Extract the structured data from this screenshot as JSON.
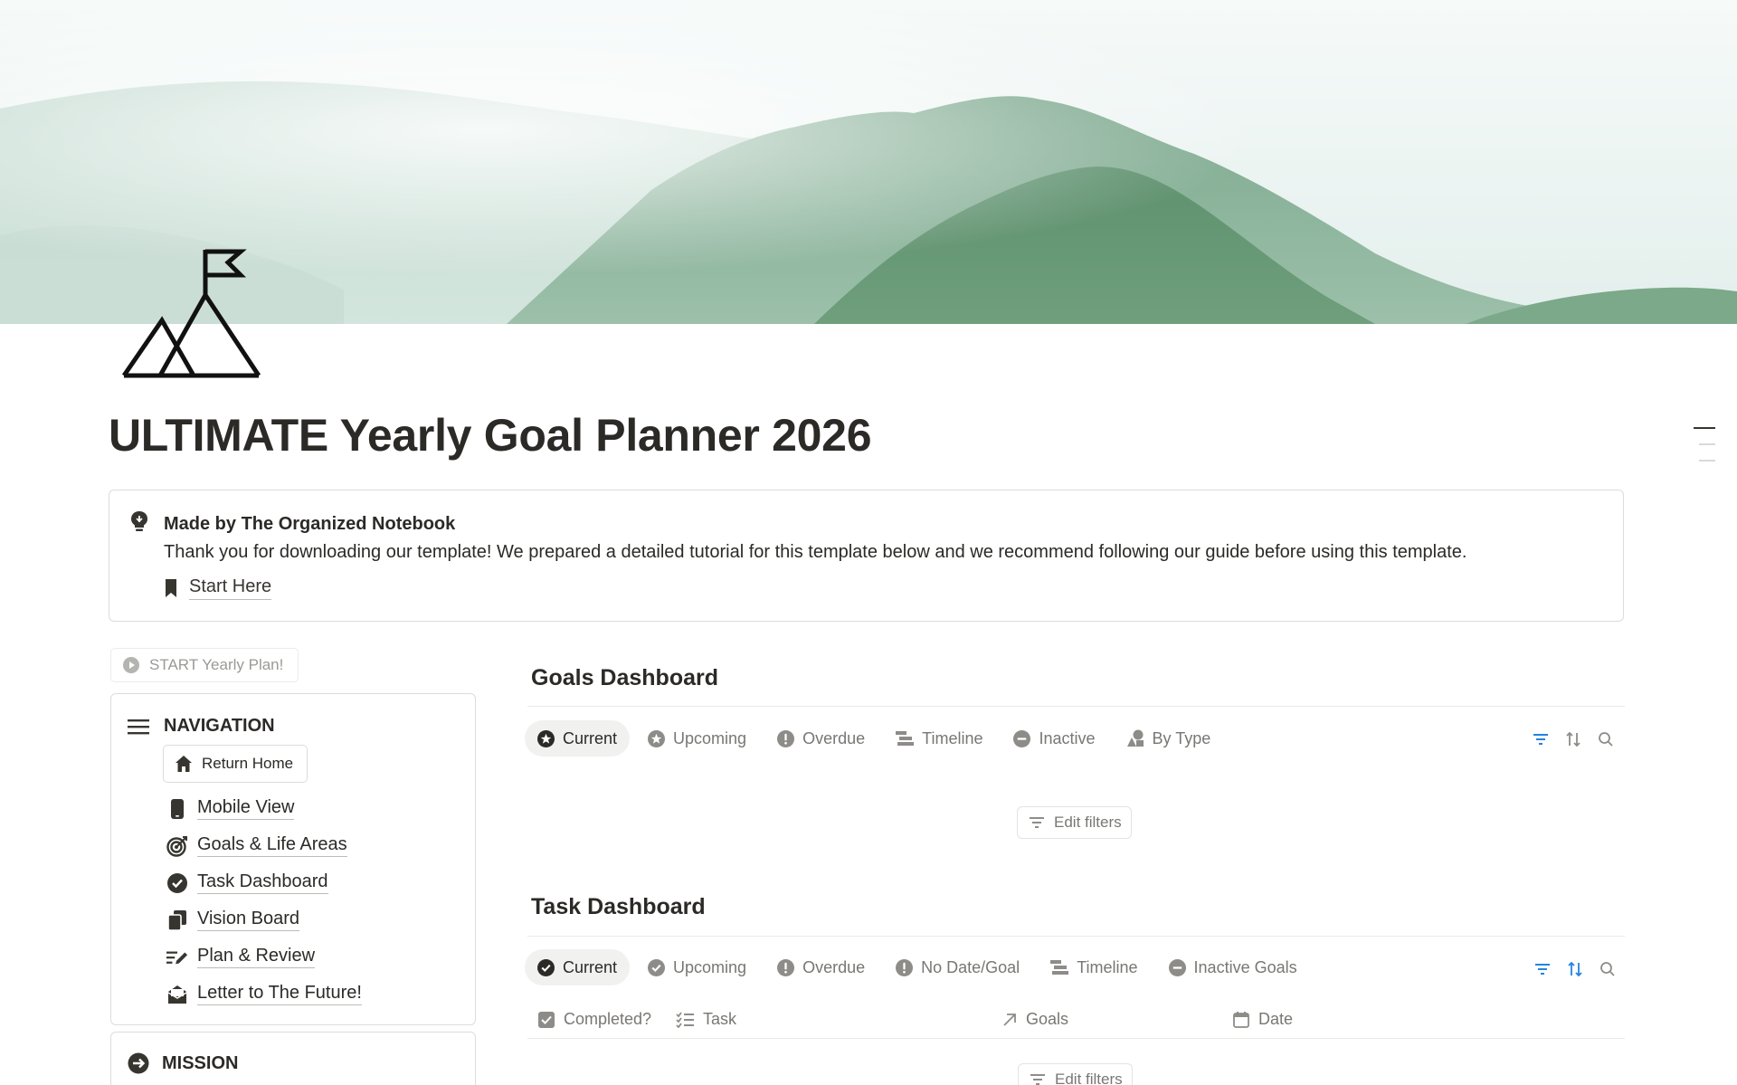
{
  "page": {
    "title": "ULTIMATE Yearly Goal Planner 2026"
  },
  "icons": {
    "page_icon": "mountain-flag-icon",
    "callout_icon": "lightbulb-icon",
    "start_here_icon": "bookmark-icon",
    "start_plan_icon": "play-circle-icon",
    "navigation_icon": "menu-icon",
    "mission_icon": "arrow-circle-right-icon"
  },
  "callout": {
    "title": "Made by The Organized Notebook",
    "body": "Thank you for downloading our template! We prepared a detailed tutorial for this template below and we recommend following our guide before using this template.",
    "link": "Start Here"
  },
  "sidebar": {
    "start_button": "START Yearly Plan!",
    "navigation": {
      "heading": "NAVIGATION",
      "return_home": "Return Home",
      "items": [
        {
          "label": "Mobile View",
          "icon": "phone-icon"
        },
        {
          "label": "Goals & Life Areas",
          "icon": "target-icon"
        },
        {
          "label": "Task Dashboard",
          "icon": "check-circle-icon"
        },
        {
          "label": "Vision Board",
          "icon": "copy-icon"
        },
        {
          "label": "Plan & Review",
          "icon": "edit-list-icon"
        },
        {
          "label": "Letter to The Future!",
          "icon": "letter-icon"
        }
      ]
    },
    "mission": {
      "heading": "MISSION"
    }
  },
  "goals_dashboard": {
    "title": "Goals Dashboard",
    "tabs": [
      {
        "label": "Current",
        "icon": "star-circle-icon",
        "active": true
      },
      {
        "label": "Upcoming",
        "icon": "star-circle-icon",
        "active": false
      },
      {
        "label": "Overdue",
        "icon": "exclamation-circle-icon",
        "active": false
      },
      {
        "label": "Timeline",
        "icon": "timeline-icon",
        "active": false
      },
      {
        "label": "Inactive",
        "icon": "minus-circle-icon",
        "active": false
      },
      {
        "label": "By Type",
        "icon": "shapes-icon",
        "active": false
      }
    ],
    "edit_filters": "Edit filters"
  },
  "task_dashboard": {
    "title": "Task Dashboard",
    "tabs": [
      {
        "label": "Current",
        "icon": "check-circle-icon",
        "active": true
      },
      {
        "label": "Upcoming",
        "icon": "check-circle-icon",
        "active": false
      },
      {
        "label": "Overdue",
        "icon": "exclamation-circle-icon",
        "active": false
      },
      {
        "label": "No Date/Goal",
        "icon": "exclamation-circle-icon",
        "active": false
      },
      {
        "label": "Timeline",
        "icon": "timeline-icon",
        "active": false
      },
      {
        "label": "Inactive Goals",
        "icon": "minus-circle-icon",
        "active": false
      }
    ],
    "columns": [
      {
        "label": "Completed?",
        "icon": "checkbox-icon"
      },
      {
        "label": "Task",
        "icon": "checklist-icon"
      },
      {
        "label": "Goals",
        "icon": "arrow-up-right-icon"
      },
      {
        "label": "Date",
        "icon": "calendar-icon"
      }
    ],
    "edit_filters": "Edit filters"
  },
  "colors": {
    "text": "#2b2a27",
    "muted": "#787774",
    "accent_blue": "#2383e2",
    "border": "#dcdcd9"
  }
}
